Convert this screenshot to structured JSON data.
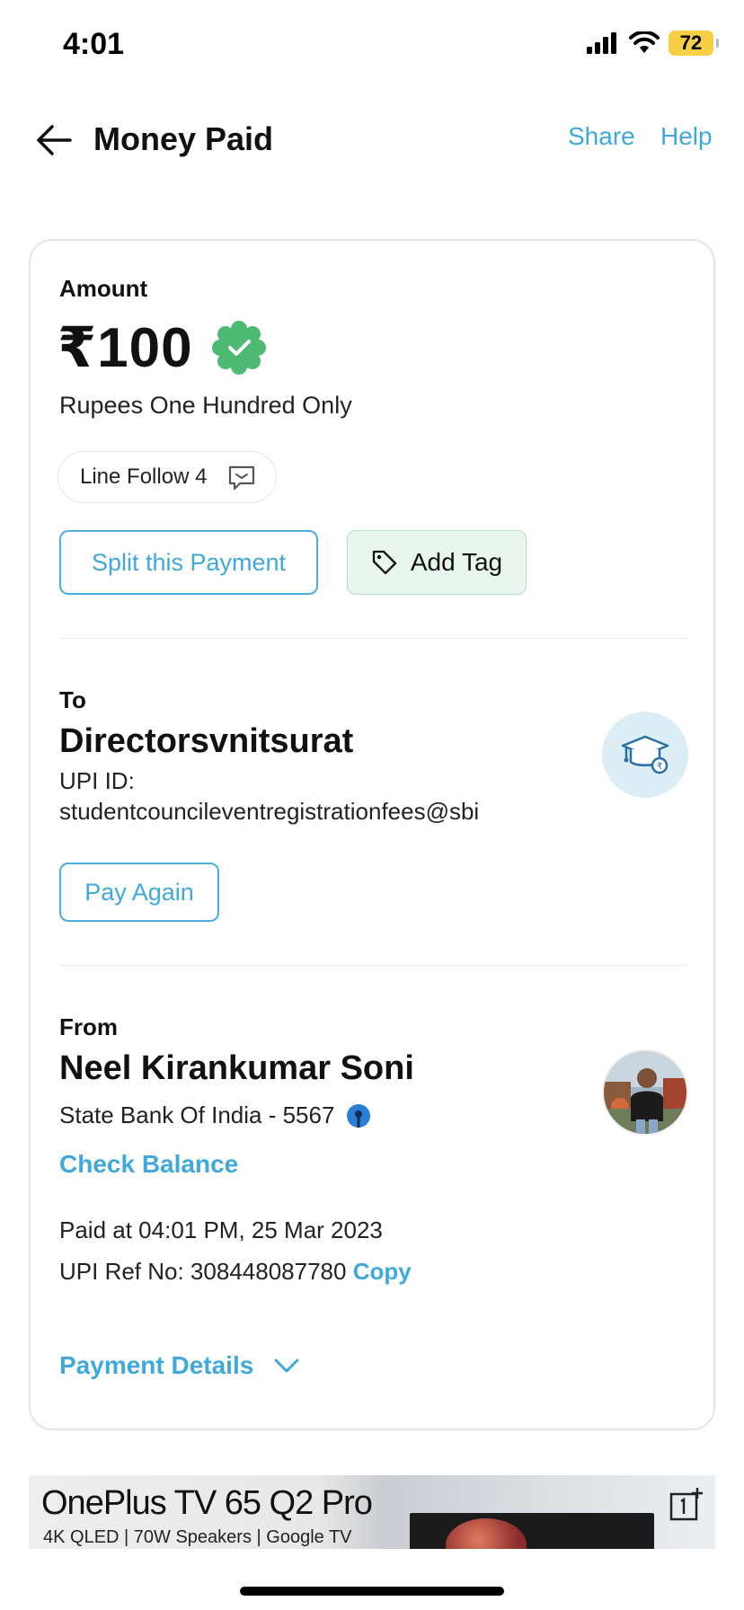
{
  "status_bar": {
    "time": "4:01",
    "battery": "72"
  },
  "header": {
    "title": "Money Paid",
    "share_label": "Share",
    "help_label": "Help"
  },
  "amount_section": {
    "label": "Amount",
    "value": "₹100",
    "words": "Rupees One Hundred Only",
    "note": "Line Follow 4",
    "split_label": "Split this Payment",
    "tag_label": "Add Tag"
  },
  "to_section": {
    "label": "To",
    "name": "Directorsvnitsurat",
    "upi_label": "UPI ID:",
    "upi_id": "studentcouncileventregistrationfees@sbi",
    "pay_again_label": "Pay Again"
  },
  "from_section": {
    "label": "From",
    "name": "Neel Kirankumar Soni",
    "bank": "State Bank Of India - 5567",
    "check_balance_label": "Check Balance",
    "paid_at": "Paid at 04:01 PM, 25 Mar 2023",
    "upi_ref_label": "UPI Ref No: 308448087780",
    "copy_label": "Copy",
    "payment_details_label": "Payment Details"
  },
  "ad": {
    "title": "OnePlus TV 65 Q2 Pro",
    "subtitle": "4K QLED | 70W Speakers | Google TV"
  },
  "colors": {
    "accent": "#3fa9dc",
    "success": "#4cba72",
    "battery": "#f6cf45",
    "tag_bg": "#e9f6ee"
  },
  "icons": {
    "back": "arrow-left-icon",
    "verified": "verified-badge-icon",
    "note": "chat-bubble-icon",
    "tag": "tag-icon",
    "to_avatar": "graduation-cap-icon",
    "bank": "sbi-logo-icon",
    "details": "chevron-down-icon",
    "ad_open": "open-external-icon"
  }
}
